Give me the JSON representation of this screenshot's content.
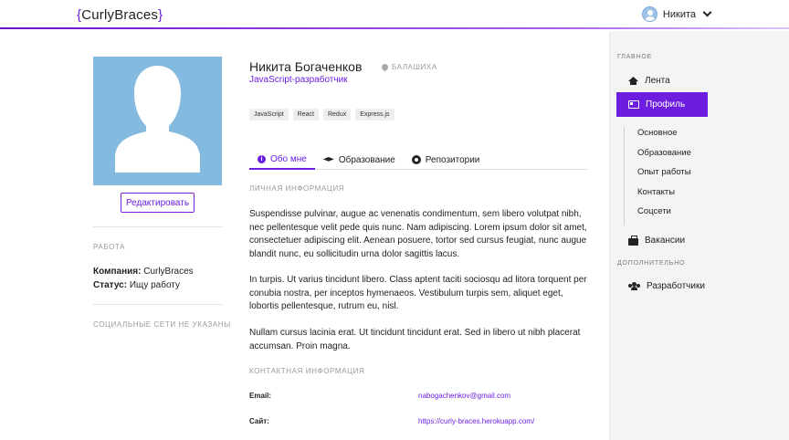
{
  "header": {
    "logo_open": "{",
    "logo_text": "CurlyBraces",
    "logo_close": "}",
    "user_name": "Никита"
  },
  "profile": {
    "edit_label": "Редактировать",
    "work_heading": "РАБОТА",
    "company_label": "Компания:",
    "company_value": "CurlyBraces",
    "status_label": "Статус:",
    "status_value": "Ищу работу",
    "social_text": "СОЦИАЛЬНЫЕ СЕТИ НЕ УКАЗАНЫ",
    "name": "Никита Богаченков",
    "location": "БАЛАШИХА",
    "role": "JavaScript-разработчик",
    "tags": [
      "JavaScript",
      "React",
      "Redux",
      "Express.js"
    ]
  },
  "tabs": {
    "about": "Обо мне",
    "education": "Образование",
    "repos": "Репозитории"
  },
  "about": {
    "personal_heading": "ЛИЧНАЯ ИНФОРМАЦИЯ",
    "paragraphs": [
      "Suspendisse pulvinar, augue ac venenatis condimentum, sem libero volutpat nibh, nec pellentesque velit pede quis nunc. Nam adipiscing. Lorem ipsum dolor sit amet, consectetuer adipiscing elit. Aenean posuere, tortor sed cursus feugiat, nunc augue blandit nunc, eu sollicitudin urna dolor sagittis lacus.",
      "In turpis. Ut varius tincidunt libero. Class aptent taciti sociosqu ad litora torquent per conubia nostra, per inceptos hymenaeos. Vestibulum turpis sem, aliquet eget, lobortis pellentesque, rutrum eu, nisl.",
      "Nullam cursus lacinia erat. Ut tincidunt tincidunt erat. Sed in libero ut nibh placerat accumsan. Proin magna."
    ],
    "contact_heading": "КОНТАКТНАЯ ИНФОРМАЦИЯ",
    "email_label": "Email:",
    "email_value": "nabogachenkov@gmail.com",
    "site_label": "Сайт:",
    "site_value": "https://curly-braces.herokuapp.com/"
  },
  "sidebar": {
    "main_heading": "ГЛАВНОЕ",
    "feed": "Лента",
    "profile": "Профиль",
    "sub_items": [
      "Основное",
      "Образование",
      "Опыт работы",
      "Контакты",
      "Соцсети"
    ],
    "vacancies": "Вакансии",
    "extra_heading": "ДОПОЛНИТЕЛЬНО",
    "developers": "Разработчики"
  },
  "colors": {
    "accent": "#6c1de0",
    "avatar_bg": "#84b9e0",
    "sidebar_bg": "#f4f4f4"
  }
}
